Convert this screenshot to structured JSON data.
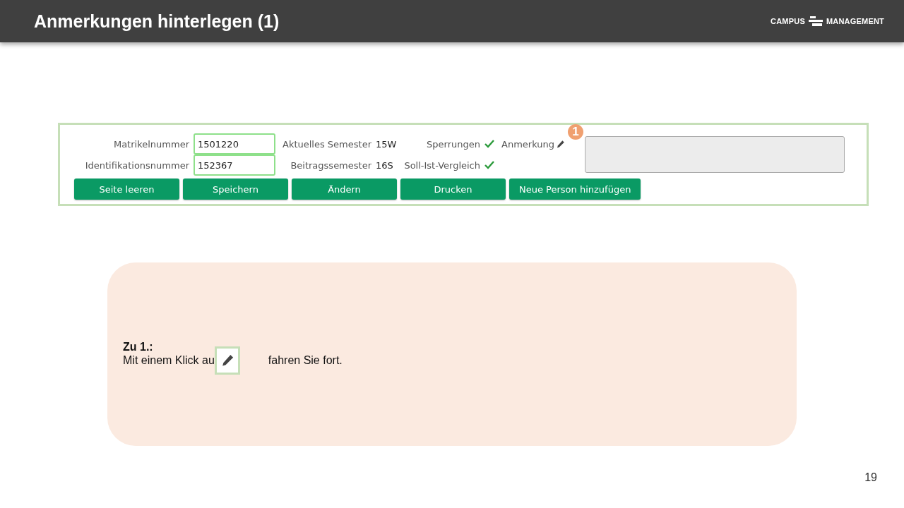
{
  "header": {
    "title": "Anmerkungen hinterlegen (1)",
    "logo_left": "CAMPUS",
    "logo_right": "MANAGEMENT"
  },
  "form": {
    "fields": [
      {
        "label": "Matrikelnummer",
        "value": "1501220"
      },
      {
        "label": "Identifikationsnummer",
        "value": "152367"
      }
    ],
    "info": [
      {
        "label": "Aktuelles Semester",
        "value": "15W"
      },
      {
        "label": "Beitragssemester",
        "value": "16S"
      }
    ],
    "checks": [
      {
        "label": "Sperrungen",
        "checked": true
      },
      {
        "label": "Soll-Ist-Vergleich",
        "checked": true
      }
    ],
    "note": {
      "label": "Anmerkung",
      "marker": "1"
    },
    "buttons": [
      "Seite leeren",
      "Speichern",
      "Ändern",
      "Drucken",
      "Neue Person hinzufügen"
    ]
  },
  "explanation": {
    "heading": "Zu 1.:",
    "text_before": "Mit einem Klick au",
    "text_after": "fahren Sie fort."
  },
  "page_number": "19"
}
